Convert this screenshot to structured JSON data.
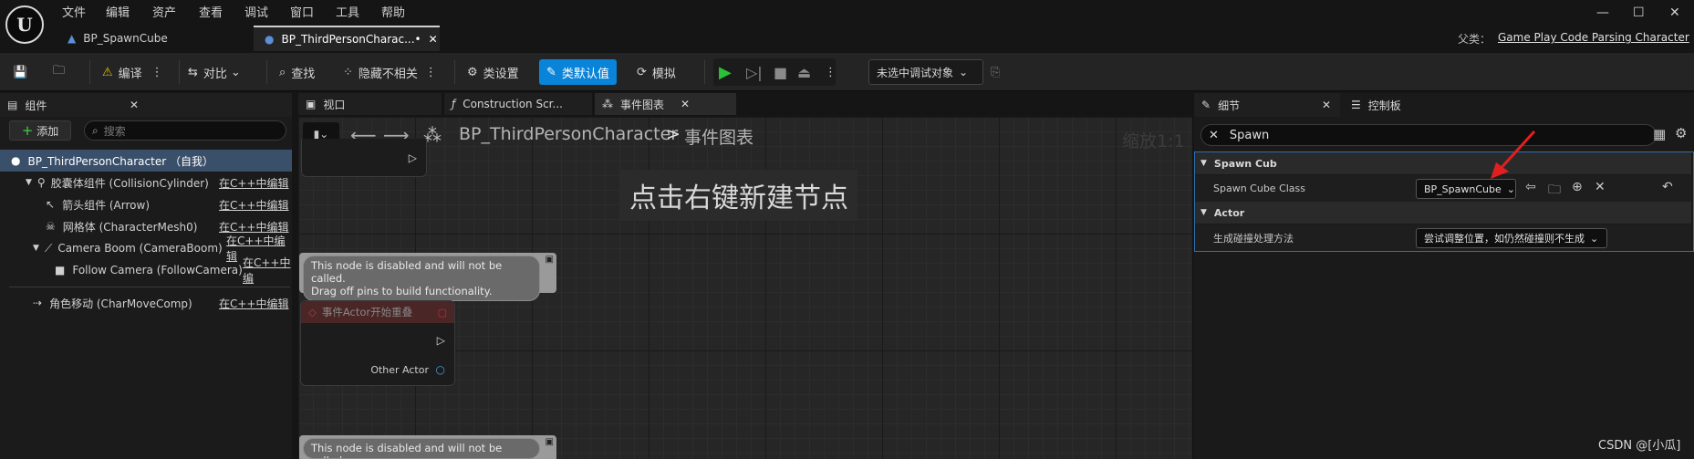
{
  "menu": [
    "文件",
    "编辑",
    "资产",
    "查看",
    "调试",
    "窗口",
    "工具",
    "帮助"
  ],
  "tabs": [
    {
      "label": "BP_SpawnCube"
    },
    {
      "label": "BP_ThirdPersonCharac...•"
    }
  ],
  "parent": {
    "label": "父类：",
    "value": "Game Play Code Parsing Character"
  },
  "toolbar": {
    "compile": "编译",
    "diff": "对比",
    "find": "查找",
    "hide_unrelated": "隐藏不相关",
    "class_settings": "类设置",
    "class_defaults": "类默认值",
    "simulate": "模拟",
    "debug_object": "未选中调试对象"
  },
  "components": {
    "title": "组件",
    "add": "添加",
    "search_placeholder": "搜索",
    "items": [
      {
        "name": "BP_ThirdPersonCharacter （自我）",
        "edit": ""
      },
      {
        "name": "胶囊体组件 (CollisionCylinder)",
        "edit": "在C++中编辑"
      },
      {
        "name": "箭头组件 (Arrow)",
        "edit": "在C++中编辑"
      },
      {
        "name": "网格体 (CharacterMesh0)",
        "edit": "在C++中编辑"
      },
      {
        "name": "Camera Boom (CameraBoom)",
        "edit": "在C++中编辑"
      },
      {
        "name": "Follow Camera (FollowCamera)",
        "edit": "在C++中编"
      },
      {
        "name": "角色移动 (CharMoveComp)",
        "edit": "在C++中编辑"
      }
    ]
  },
  "graph": {
    "tabs": [
      "视口",
      "Construction Scr...",
      "事件图表"
    ],
    "breadcrumb_root": "BP_ThirdPersonCharacter",
    "breadcrumb_sep": ">",
    "breadcrumb_leaf": "事件图表",
    "hint": "点击右键新建节点",
    "zoom": "缩放1:1",
    "disabled_note_1": "This node is disabled and will not be called.",
    "disabled_note_2": "Drag off pins to build functionality.",
    "event_node_title": "事件Actor开始重叠",
    "event_pin": "Other Actor"
  },
  "details": {
    "title": "细节",
    "palette": "控制板",
    "search_value": "Spawn",
    "categories": [
      {
        "name": "Spawn Cub",
        "props": [
          {
            "label": "Spawn Cube Class",
            "value": "BP_SpawnCube"
          }
        ]
      },
      {
        "name": "Actor",
        "props": [
          {
            "label": "生成碰撞处理方法",
            "value": "尝试调整位置，如仍然碰撞则不生成"
          }
        ]
      }
    ]
  },
  "watermark": "CSDN @[小瓜]",
  "colors": {
    "accent_blue": "#0a84d8",
    "play_green": "#2bbf3a",
    "arrow_red": "#e02020"
  }
}
